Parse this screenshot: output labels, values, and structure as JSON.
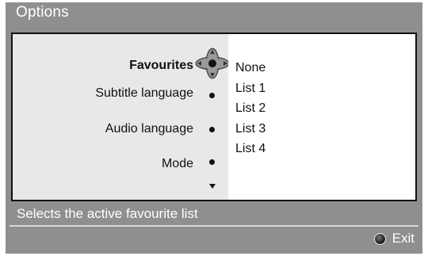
{
  "window": {
    "title": "Options"
  },
  "menu": {
    "items": [
      {
        "label": "Favourites",
        "active": true
      },
      {
        "label": "Subtitle language",
        "active": false
      },
      {
        "label": "Audio language",
        "active": false
      },
      {
        "label": "Mode",
        "active": false
      }
    ]
  },
  "options": [
    "None",
    "List 1",
    "List 2",
    "List 3",
    "List 4"
  ],
  "help_text": "Selects the active favourite list",
  "footer": {
    "exit_label": "Exit",
    "exit_icon": "color-key-dot-icon"
  },
  "colors": {
    "frame": "#8f8f8f",
    "panel_left": "#e8e8e8",
    "panel_right": "#ffffff",
    "text_light": "#ffffff",
    "text_dark": "#111111"
  }
}
